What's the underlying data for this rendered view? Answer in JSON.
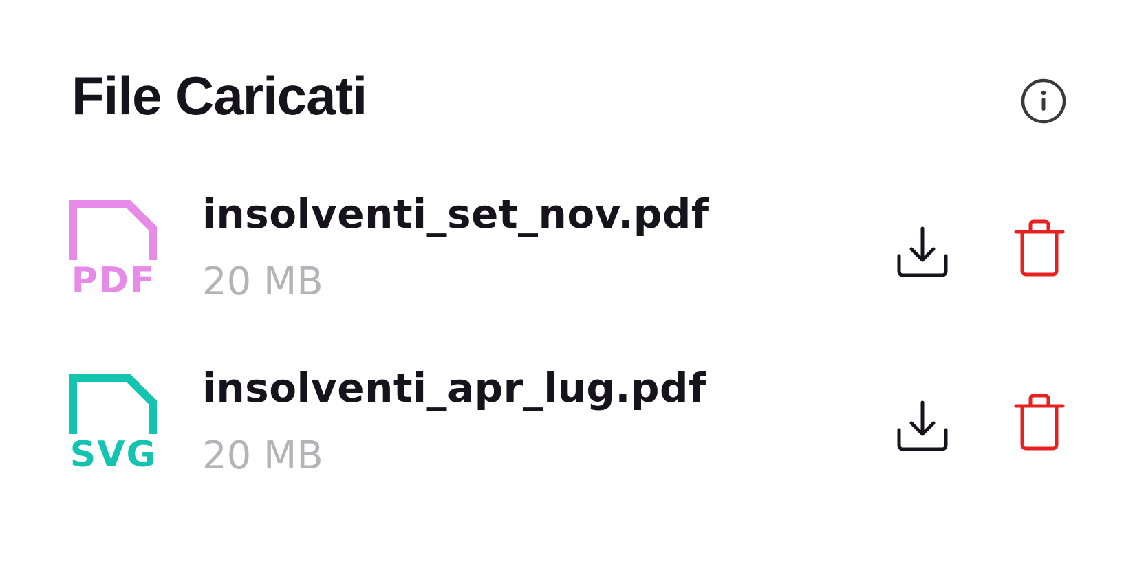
{
  "header": {
    "title": "File Caricati",
    "info_icon": "info-icon"
  },
  "files": [
    {
      "name": "insolventi_set_nov.pdf",
      "size": "20 MB",
      "type_label": "PDF",
      "type_color": "#e88ae8",
      "icon": "file-icon"
    },
    {
      "name": "insolventi_apr_lug.pdf",
      "size": "20 MB",
      "type_label": "SVG",
      "type_color": "#14c4b0",
      "icon": "file-icon"
    }
  ],
  "actions": {
    "download_icon": "download-icon",
    "delete_icon": "trash-icon",
    "download_color": "#16131c",
    "delete_color": "#e52222"
  },
  "colors": {
    "text_primary": "#16131c",
    "text_secondary": "#b5b3b8",
    "background": "#ffffff"
  }
}
